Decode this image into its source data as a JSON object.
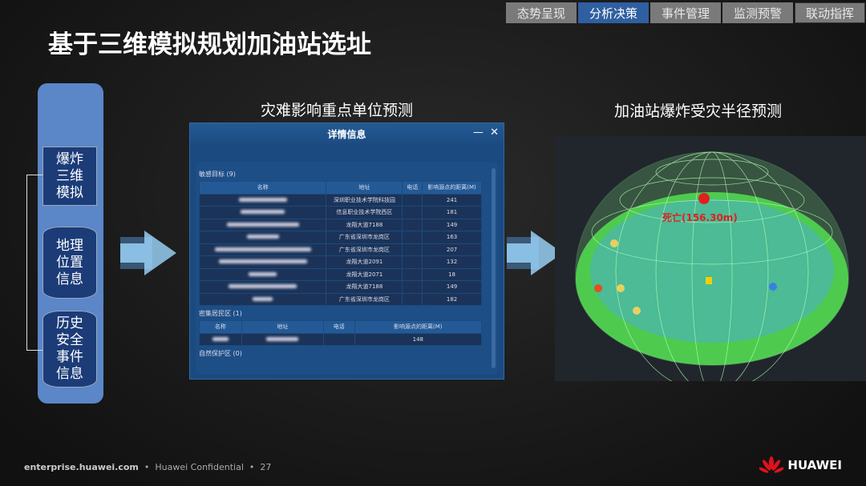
{
  "nav": {
    "tabs": [
      "态势呈现",
      "分析决策",
      "事件管理",
      "监测预警",
      "联动指挥"
    ],
    "active": 1
  },
  "title": "基于三维模拟规划加油站选址",
  "pillar": [
    "爆炸\n三维\n模拟",
    "地理\n位置\n信息",
    "历史\n安全\n事件\n信息"
  ],
  "captions": {
    "left": "灾难影响重点单位预测",
    "right": "加油站爆炸受灾半径预测"
  },
  "dialog": {
    "title": "详情信息",
    "minimize": "—",
    "close": "✕",
    "sections": [
      {
        "label": "敏感目标 (9)",
        "headers": [
          "名称",
          "地址",
          "电话",
          "影响源点的距离(M)"
        ],
        "rows": [
          [
            "深圳职业技术学院科技园",
            "241"
          ],
          [
            "信息职业技术学院西区",
            "181"
          ],
          [
            "龙翔大道7188",
            "149"
          ],
          [
            "广东省深圳市龙岗区",
            "163"
          ],
          [
            "广东省深圳市龙岗区",
            "207"
          ],
          [
            "龙翔大道2091",
            "132"
          ],
          [
            "龙翔大道2071",
            "18"
          ],
          [
            "龙翔大道7188",
            "149"
          ],
          [
            "广东省深圳市龙岗区",
            "182"
          ]
        ]
      },
      {
        "label": "密集居民区 (1)",
        "headers": [
          "名称",
          "地址",
          "电话",
          "影响源点的距离(M)"
        ],
        "rows": [
          [
            "",
            "148"
          ]
        ]
      },
      {
        "label": "自然保护区 (0)"
      }
    ]
  },
  "scene": {
    "label": "死亡(156.30m)"
  },
  "footer": {
    "site": "enterprise.huawei.com",
    "conf": "Huawei Confidential",
    "page": "27",
    "brand": "HUAWEI"
  }
}
